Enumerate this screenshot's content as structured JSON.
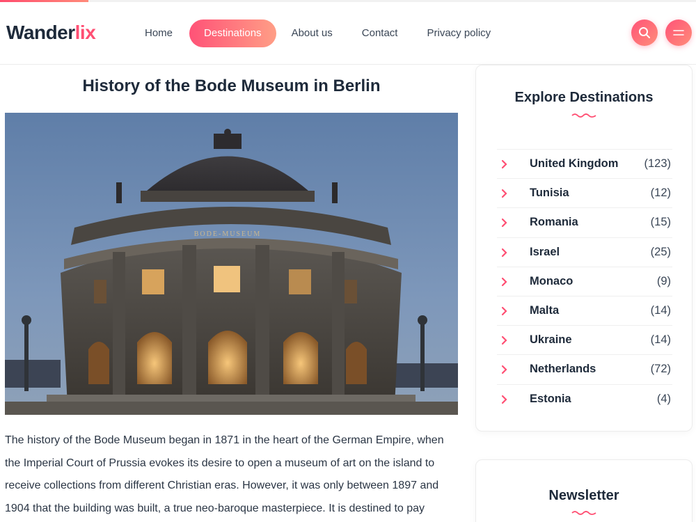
{
  "reading_progress": 0.127,
  "brand": {
    "logo_part1": "Wander",
    "logo_part2": "lix",
    "accent_color": "#ff4f73"
  },
  "nav": {
    "items": [
      {
        "label": "Home",
        "active": false
      },
      {
        "label": "Destinations",
        "active": true
      },
      {
        "label": "About us",
        "active": false
      },
      {
        "label": "Contact",
        "active": false
      },
      {
        "label": "Privacy policy",
        "active": false
      }
    ]
  },
  "header_buttons": {
    "search_icon": "search-icon",
    "menu_icon": "menu-icon"
  },
  "article": {
    "title": "History of the Bode Museum in Berlin",
    "image_inscription": "BODE-MUSEUM",
    "body": "The history of the Bode Museum began in 1871 in the heart of the German Empire, when the Imperial Court of Prussia evokes its desire to open a museum of art on the island to receive collections from different Christian eras. However, it was only between 1897 and 1904 that the building was built, a true neo-baroque masterpiece. It is destined to pay"
  },
  "sidebar": {
    "explore": {
      "title": "Explore Destinations",
      "items": [
        {
          "name": "United Kingdom",
          "count": "(123)"
        },
        {
          "name": "Tunisia",
          "count": "(12)"
        },
        {
          "name": "Romania",
          "count": "(15)"
        },
        {
          "name": "Israel",
          "count": "(25)"
        },
        {
          "name": "Monaco",
          "count": "(9)"
        },
        {
          "name": "Malta",
          "count": "(14)"
        },
        {
          "name": "Ukraine",
          "count": "(14)"
        },
        {
          "name": "Netherlands",
          "count": "(72)"
        },
        {
          "name": "Estonia",
          "count": "(4)"
        }
      ]
    },
    "newsletter": {
      "title": "Newsletter"
    }
  }
}
